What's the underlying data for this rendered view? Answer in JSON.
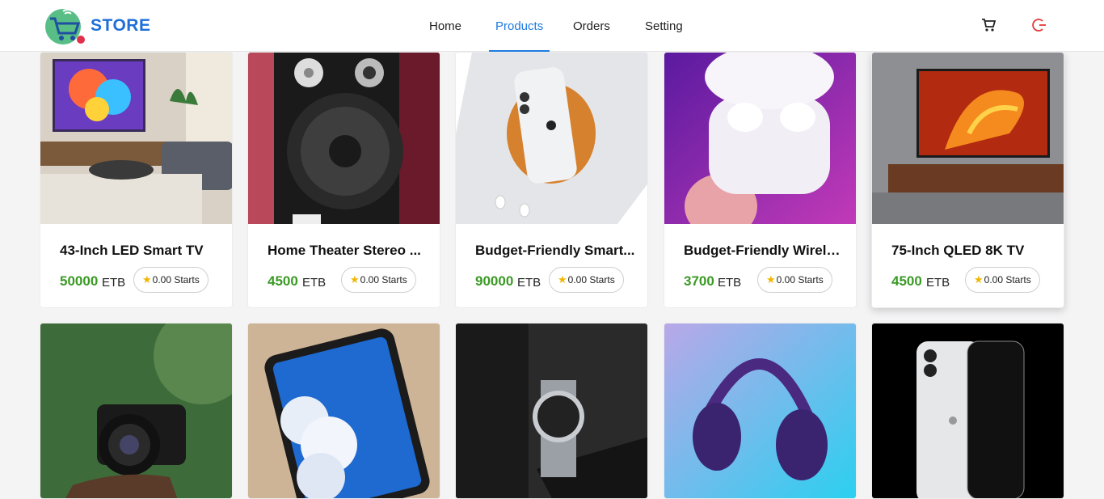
{
  "brand": {
    "name": "STORE"
  },
  "nav": [
    {
      "label": "Home"
    },
    {
      "label": "Products",
      "active": true
    },
    {
      "label": "Orders"
    },
    {
      "label": "Setting"
    }
  ],
  "header_icons": [
    "cart-icon",
    "logout-icon"
  ],
  "colors": {
    "brand": "#1e6fd9",
    "accent": "#1e7be0",
    "price": "#3a9a24",
    "star": "#f2b600",
    "logout": "#e53935"
  },
  "products": [
    {
      "title": "43-Inch LED Smart TV",
      "price": "50000",
      "currency": "ETB",
      "rating": "0.00 Starts"
    },
    {
      "title": "Home Theater Stereo ...",
      "price": "4500",
      "currency": "ETB",
      "rating": "0.00 Starts"
    },
    {
      "title": "Budget-Friendly Smart...",
      "price": "90000",
      "currency": "ETB",
      "rating": "0.00 Starts"
    },
    {
      "title": "Budget-Friendly Wirele...",
      "price": "3700",
      "currency": "ETB",
      "rating": "0.00 Starts"
    },
    {
      "title": "75-Inch QLED 8K TV",
      "price": "4500",
      "currency": "ETB",
      "rating": "0.00 Starts"
    }
  ]
}
